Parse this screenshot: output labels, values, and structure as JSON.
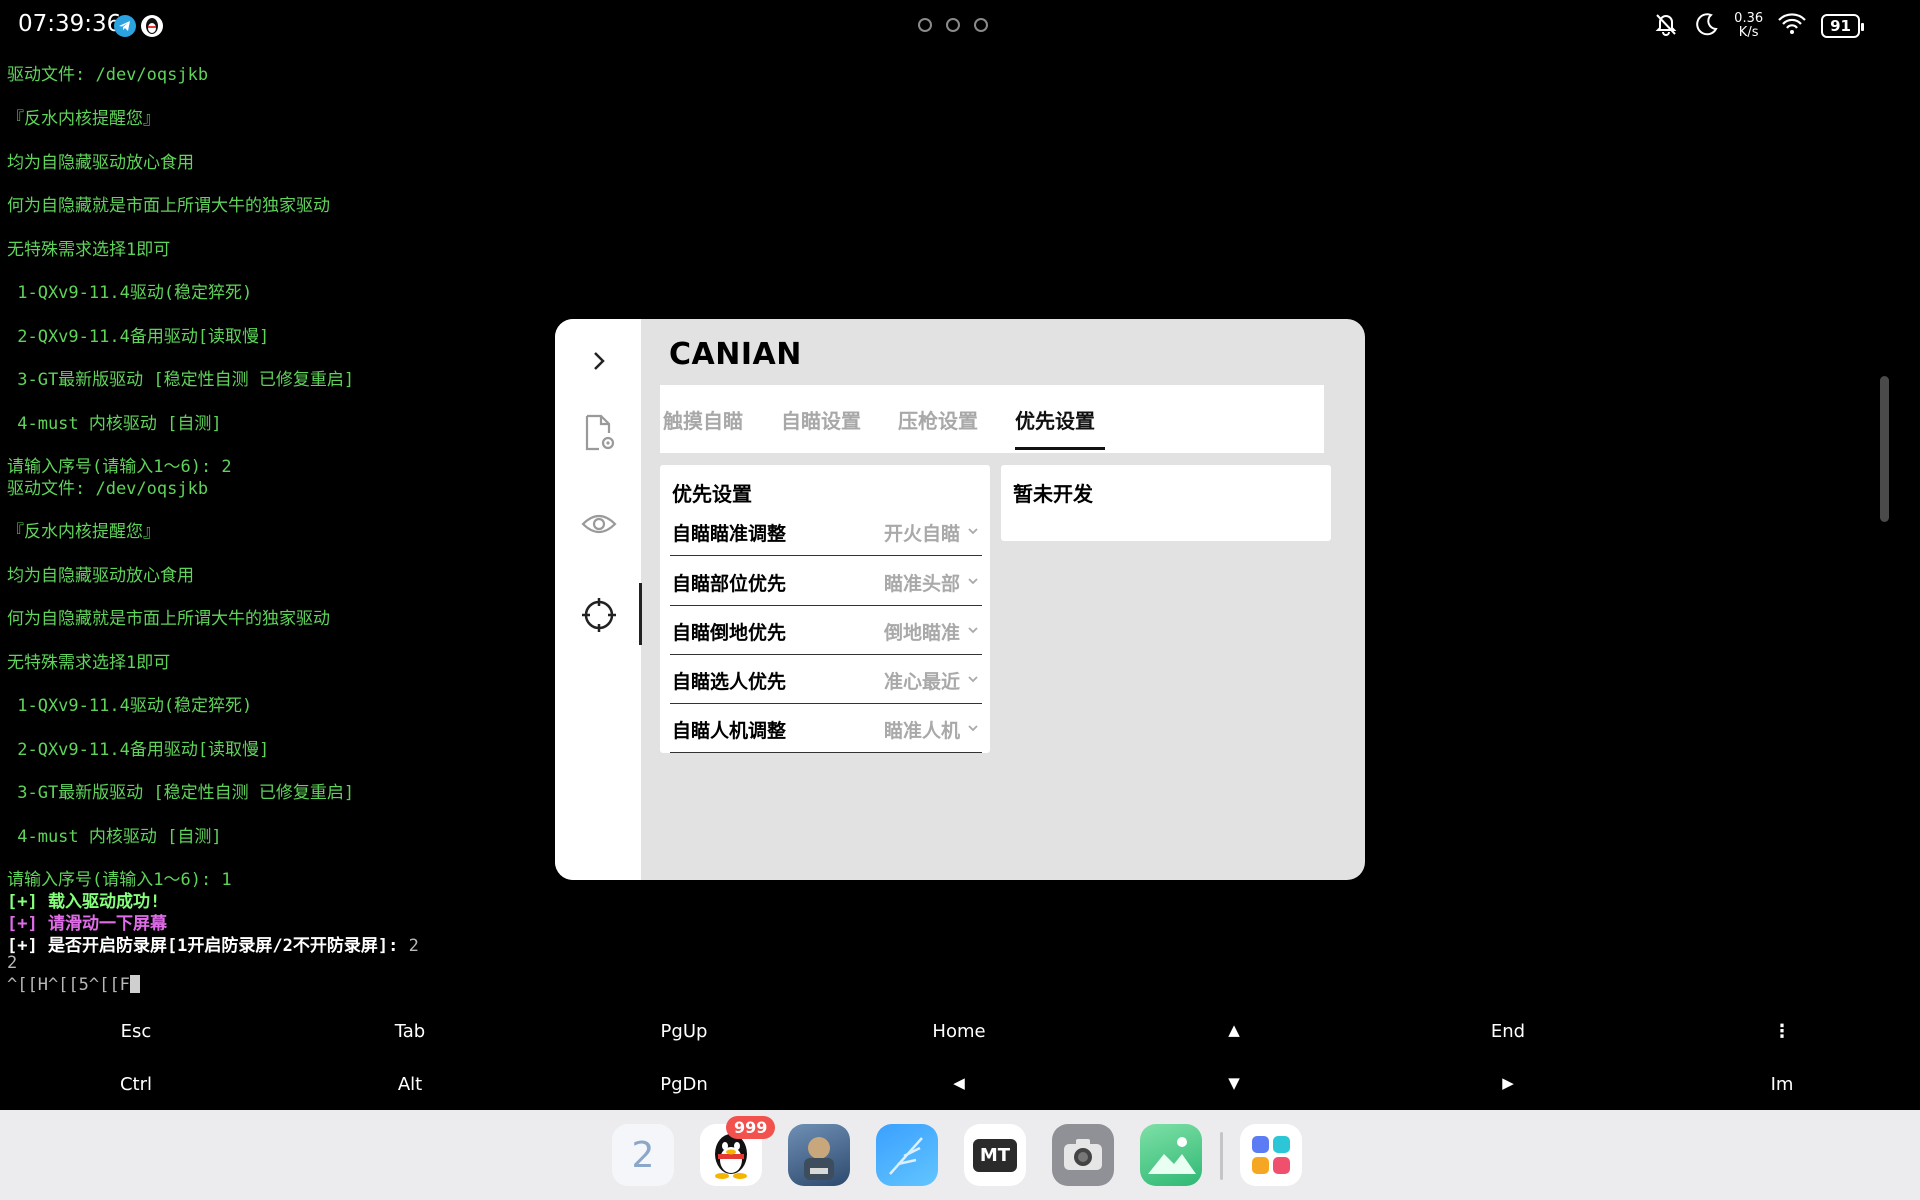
{
  "status_bar": {
    "time": "07:39:36",
    "net_speed_value": "0.36",
    "net_speed_unit": "K/s",
    "battery": "91",
    "icons": [
      "telegram-icon",
      "qq-icon",
      "mute-icon",
      "moon-icon",
      "wifi-icon",
      "battery-icon"
    ]
  },
  "terminal": {
    "lines": [
      "驱动文件: /dev/oqsjkb",
      "『反水内核提醒您』",
      "均为自隐藏驱动放心食用",
      "何为自隐藏就是市面上所谓大牛的独家驱动",
      "无特殊需求选择1即可",
      " 1-QXv9-11.4驱动(稳定猝死)",
      " 2-QXv9-11.4备用驱动[读取慢]",
      " 3-GT最新版驱动 [稳定性自测 已修复重启]",
      " 4-must 内核驱动 [自测]",
      "请输入序号(请输入1～6): 2",
      "驱动文件: /dev/oqsjkb",
      "『反水内核提醒您』",
      "均为自隐藏驱动放心食用",
      "何为自隐藏就是市面上所谓大牛的独家驱动",
      "无特殊需求选择1即可",
      " 1-QXv9-11.4驱动(稳定猝死)",
      " 2-QXv9-11.4备用驱动[读取慢]",
      " 3-GT最新版驱动 [稳定性自测 已修复重启]",
      " 4-must 内核驱动 [自测]",
      "请输入序号(请输入1～6): 1",
      "[+] 载入驱动成功!",
      "[+] 请滑动一下屏幕",
      "[+] 是否开启防录屏[1开启防录屏/2不开防录屏]: ",
      "2",
      "2",
      "^[[H^[[5^[[F"
    ]
  },
  "extra_keys": {
    "row1": [
      "Esc",
      "Tab",
      "PgUp",
      "Home",
      "▲",
      "End",
      "⋮"
    ],
    "row2": [
      "Ctrl",
      "Alt",
      "PgDn",
      "◀",
      "▼",
      "▶",
      "Im"
    ]
  },
  "panel": {
    "brand": "CANIAN",
    "tabs": [
      "触摸自瞄",
      "自瞄设置",
      "压枪设置",
      "优先设置"
    ],
    "active_tab": 3,
    "left_card_title": "优先设置",
    "rows": [
      {
        "label": "自瞄瞄准调整",
        "value": "开火自瞄"
      },
      {
        "label": "自瞄部位优先",
        "value": "瞄准头部"
      },
      {
        "label": "自瞄倒地优先",
        "value": "倒地瞄准"
      },
      {
        "label": "自瞄选人优先",
        "value": "准心最近"
      },
      {
        "label": "自瞄人机调整",
        "value": "瞄准人机"
      }
    ],
    "right_card_text": "暂未开发"
  },
  "dock": {
    "badge": "999",
    "first_app_label": "2",
    "apps": [
      "app-2-icon",
      "qq-icon",
      "pubg-icon",
      "feather-icon",
      "mt-manager-icon",
      "camera-icon",
      "gallery-icon",
      "app-drawer-icon"
    ],
    "mt_label": "MT"
  }
}
